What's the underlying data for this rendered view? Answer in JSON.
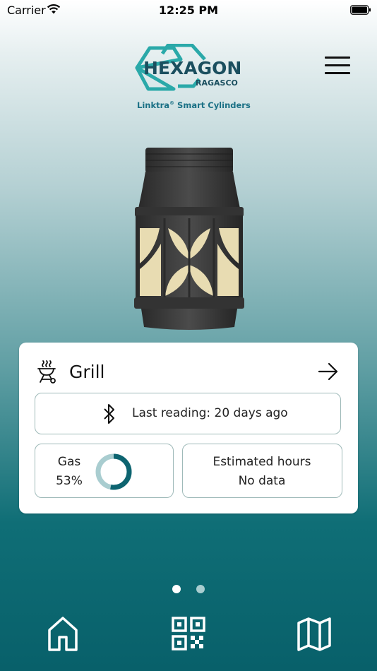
{
  "status_bar": {
    "carrier": "Carrier",
    "time": "12:25 PM",
    "icons": [
      "wifi-icon",
      "battery-icon"
    ]
  },
  "brand": {
    "name": "HEXAGON",
    "sub": "RAGASCO",
    "tagline_main": "Linktra",
    "tagline_mark": "®",
    "tagline_rest": " Smart Cylinders",
    "colors": {
      "hex_outline": "#2aa9a9",
      "wordmark": "#1b4f5f",
      "tagline": "#1a7085"
    }
  },
  "header": {
    "menu_icon": "hamburger-menu-icon"
  },
  "cylinder_card": {
    "name": "Grill",
    "type_icon": "grill-icon",
    "open_icon": "arrow-right-icon",
    "reading": {
      "icon": "bluetooth-icon",
      "text": "Last reading: 20 days ago"
    },
    "gas": {
      "label": "Gas",
      "value": "53%",
      "level": 0.53,
      "ring_color": "#0d6470",
      "ring_track_color": "#a9cdd0"
    },
    "estimated_hours": {
      "label": "Estimated hours",
      "value": "No data"
    }
  },
  "pager": {
    "count": 2,
    "active": 1
  },
  "bottom_nav": [
    {
      "icon": "home-icon"
    },
    {
      "icon": "qr-code-icon"
    },
    {
      "icon": "map-icon"
    }
  ]
}
